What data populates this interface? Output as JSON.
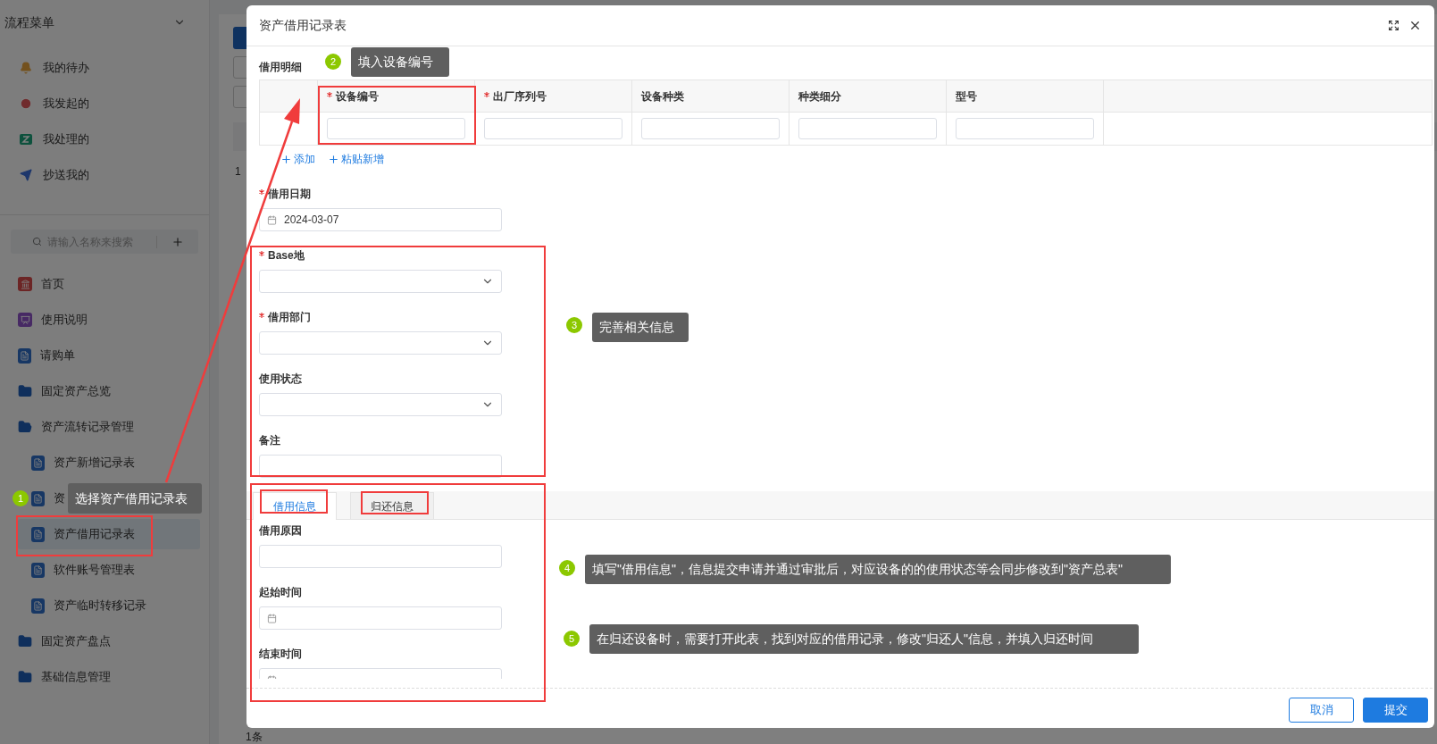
{
  "sidebar": {
    "title": "流程菜单",
    "flow_items": [
      {
        "kind": "todo",
        "label": "我的待办"
      },
      {
        "kind": "started",
        "label": "我发起的"
      },
      {
        "kind": "handled",
        "label": "我处理的"
      },
      {
        "kind": "cc",
        "label": "抄送我的"
      }
    ],
    "search": {
      "placeholder": "请输入名称来搜索"
    },
    "nav": [
      {
        "kind": "home",
        "label": "首页",
        "selected": false
      },
      {
        "kind": "guide",
        "label": "使用说明",
        "selected": false
      },
      {
        "kind": "form",
        "label": "请购单",
        "selected": false
      },
      {
        "kind": "folder",
        "label": "固定资产总览",
        "selected": false,
        "expanded": false
      },
      {
        "kind": "folder",
        "label": "资产流转记录管理",
        "selected": false,
        "expanded": true,
        "children": [
          {
            "kind": "form",
            "label": "资产新增记录表",
            "selected": false
          },
          {
            "kind": "form",
            "label": "资",
            "selected": false
          },
          {
            "kind": "form",
            "label": "资产借用记录表",
            "selected": true
          },
          {
            "kind": "form",
            "label": "软件账号管理表",
            "selected": false
          },
          {
            "kind": "form",
            "label": "资产临时转移记录",
            "selected": false
          }
        ]
      },
      {
        "kind": "folder",
        "label": "固定资产盘点",
        "selected": false,
        "expanded": false
      },
      {
        "kind": "folder",
        "label": "基础信息管理",
        "selected": false,
        "expanded": false
      }
    ]
  },
  "background": {
    "row_number": "1",
    "footer": "1条"
  },
  "dialog": {
    "title": "资产借用记录表",
    "detail": {
      "label": "借用明细",
      "columns": [
        {
          "label": "设备编号",
          "required": true
        },
        {
          "label": "出厂序列号",
          "required": true
        },
        {
          "label": "设备种类",
          "required": false
        },
        {
          "label": "种类细分",
          "required": false
        },
        {
          "label": "型号",
          "required": false
        }
      ],
      "actions": [
        "添加",
        "粘贴新增"
      ]
    },
    "fields": [
      {
        "kind": "date",
        "label": "借用日期",
        "required": true,
        "value": "2024-03-07"
      },
      {
        "kind": "select",
        "label": "Base地",
        "required": true
      },
      {
        "kind": "select",
        "label": "借用部门",
        "required": true
      },
      {
        "kind": "select",
        "label": "使用状态",
        "required": false
      },
      {
        "kind": "text",
        "label": "备注",
        "required": false
      }
    ],
    "tabs": [
      {
        "label": "借用信息",
        "selected": true
      },
      {
        "label": "归还信息",
        "selected": false
      }
    ],
    "tab_fields": [
      {
        "kind": "text",
        "label": "借用原因",
        "required": false
      },
      {
        "kind": "date",
        "label": "起始时间",
        "required": false
      },
      {
        "kind": "date",
        "label": "结束时间",
        "required": false
      }
    ],
    "buttons": [
      {
        "kind": "secondary",
        "label": "取消"
      },
      {
        "kind": "primary",
        "label": "提交"
      }
    ]
  },
  "annotations": [
    {
      "number": "1",
      "text": "选择资产借用记录表"
    },
    {
      "number": "2",
      "text": "填入设备编号"
    },
    {
      "number": "3",
      "text": "完善相关信息"
    },
    {
      "number": "4",
      "text": "填写\"借用信息\"，信息提交申请并通过审批后，对应设备的的使用状态等会同步修改到\"资产总表\""
    },
    {
      "number": "5",
      "text": "在归还设备时，需要打开此表，找到对应的借用记录，修改\"归还人\"信息，并填入归还时间"
    }
  ]
}
